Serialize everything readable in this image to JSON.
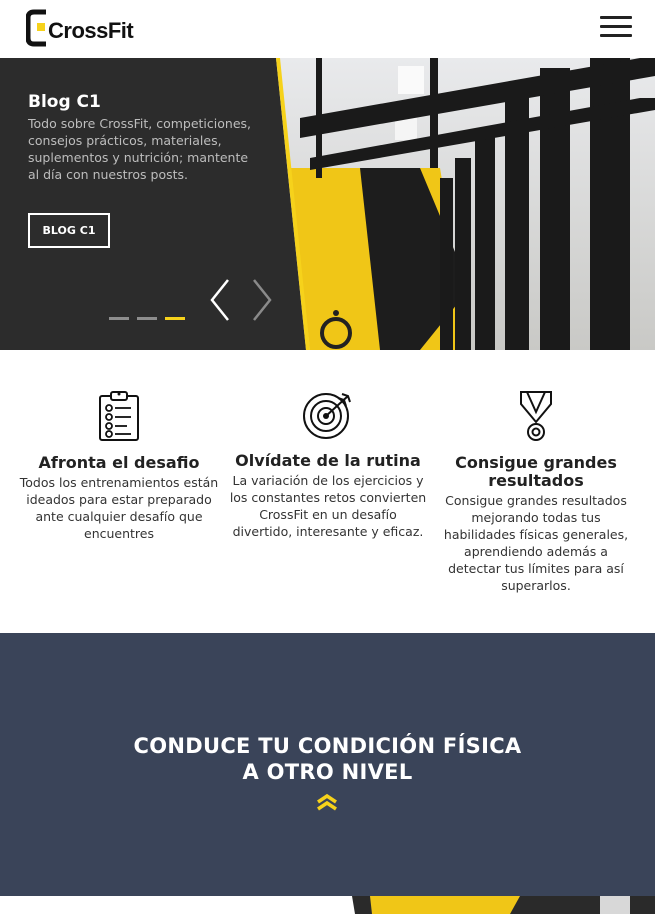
{
  "header": {
    "logo_text": "CrossFit",
    "menu_icon": "hamburger-icon"
  },
  "hero": {
    "title": "Blog C1",
    "text": "Todo sobre CrossFit, competiciones, consejos prácticos, materiales, suplementos y nutrición; mantente al día con nuestros posts.",
    "button_label": "BLOG C1",
    "slide_count": 3,
    "active_slide": 3,
    "accent_color": "#f6d21b"
  },
  "features": [
    {
      "icon": "clipboard-checklist-icon",
      "title": "Afronta el desafio",
      "text": "Todos los entrenamientos están ideados para estar preparado ante cualquier desafío que encuentres"
    },
    {
      "icon": "target-arrows-icon",
      "title": "Olvídate de la rutina",
      "text": "La variación de los ejercicios y los constantes retos convierten CrossFit en un desafío divertido, interesante y eficaz."
    },
    {
      "icon": "medal-icon",
      "title": "Consigue grandes resultados",
      "text": "Consigue grandes resultados mejorando todas tus habilidades físicas generales, aprendiendo además a detectar tus límites para así superarlos."
    }
  ],
  "banner": {
    "title_line1": "CONDUCE TU CONDICIÓN FÍSICA",
    "title_line2": "A OTRO NIVEL",
    "background": "#3a4459",
    "chevron_color": "#f6d21b"
  }
}
